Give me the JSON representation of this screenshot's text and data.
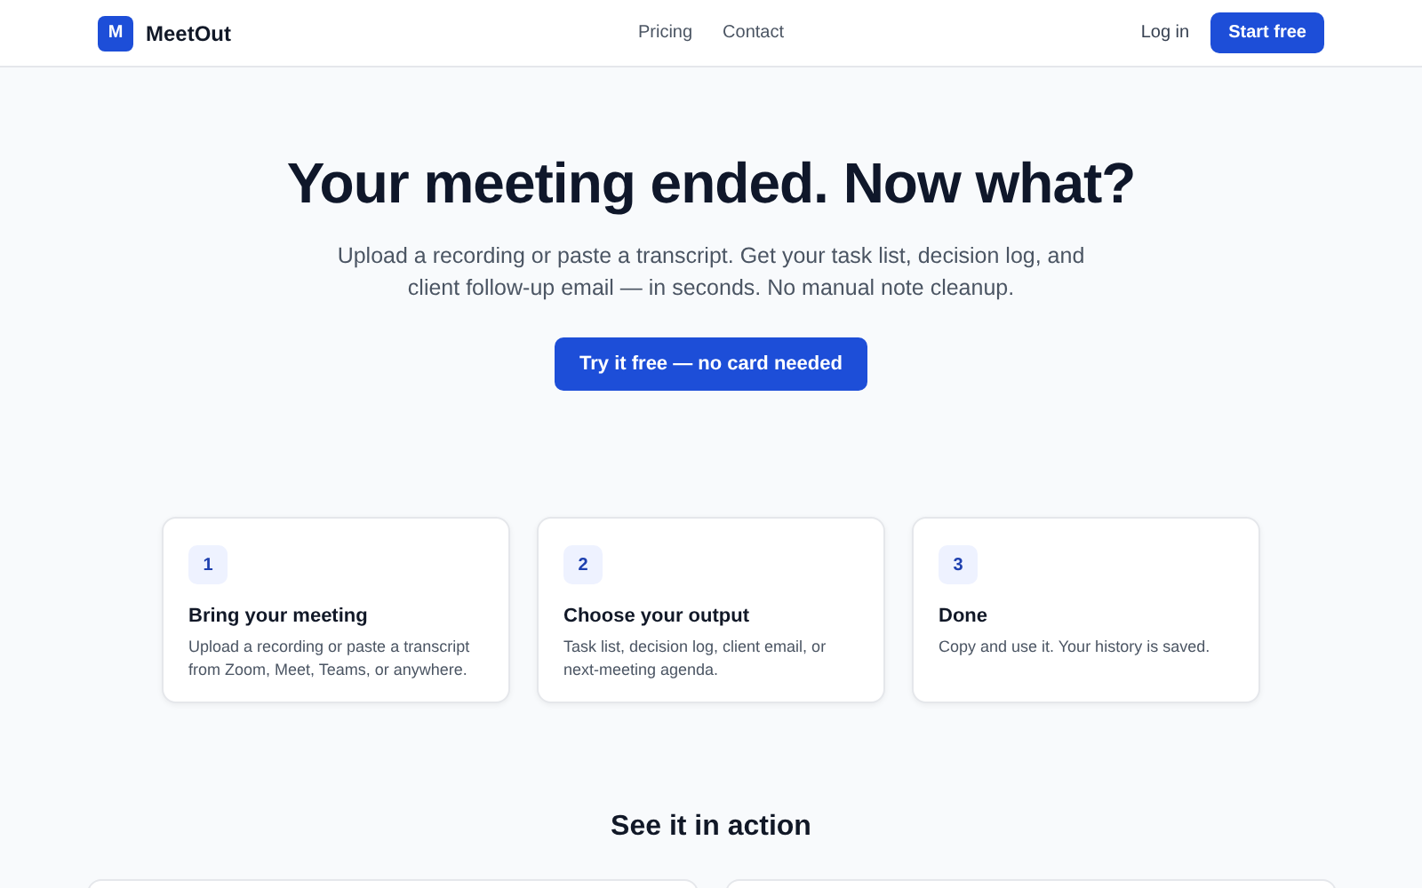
{
  "header": {
    "logo_letter": "M",
    "brand": "MeetOut",
    "nav": [
      "Pricing",
      "Contact"
    ],
    "login": "Log in",
    "cta": "Start free"
  },
  "hero": {
    "title": "Your meeting ended. Now what?",
    "subtitle": "Upload a recording or paste a transcript. Get your task list, decision log, and client follow-up email — in seconds. No manual note cleanup.",
    "button": "Try it free — no card needed"
  },
  "steps": [
    {
      "number": "1",
      "title": "Bring your meeting",
      "text": "Upload a recording or paste a transcript from Zoom, Meet, Teams, or anywhere."
    },
    {
      "number": "2",
      "title": "Choose your output",
      "text": "Task list, decision log, client email, or next-meeting agenda."
    },
    {
      "number": "3",
      "title": "Done",
      "text": "Copy and use it. Your history is saved."
    }
  ],
  "demo": {
    "title": "See it in action"
  }
}
